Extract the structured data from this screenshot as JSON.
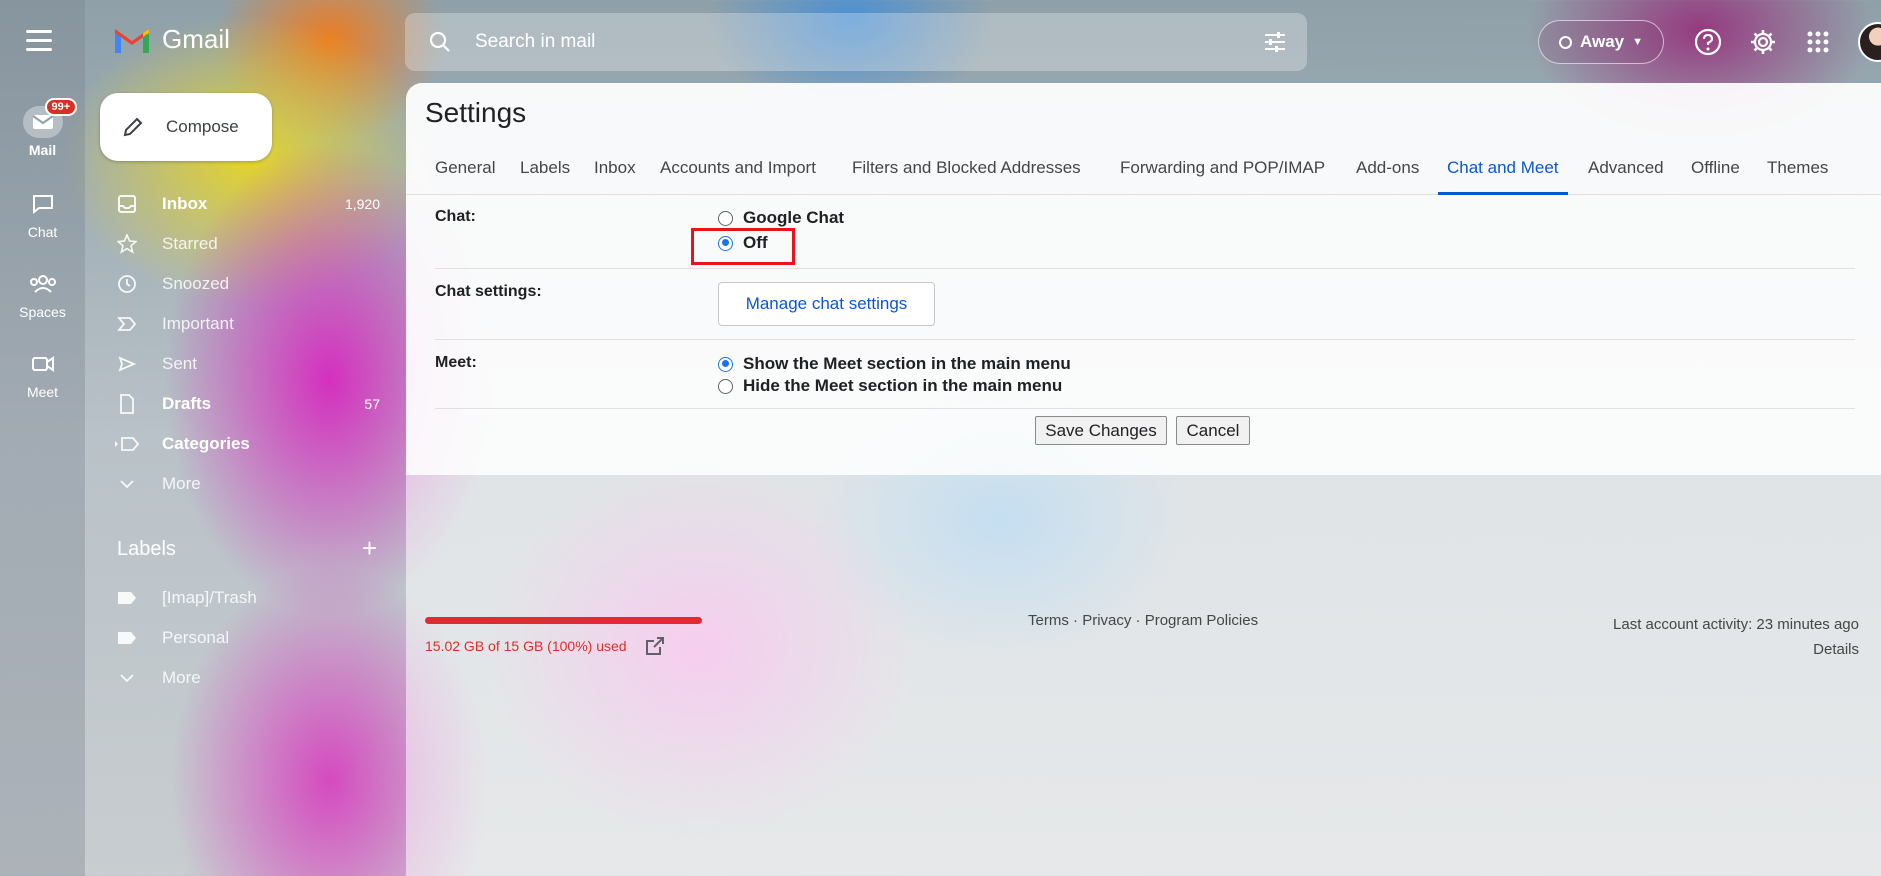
{
  "app": {
    "name": "Gmail"
  },
  "rail": {
    "items": [
      {
        "label": "Mail",
        "badge": "99+"
      },
      {
        "label": "Chat"
      },
      {
        "label": "Spaces"
      },
      {
        "label": "Meet"
      }
    ]
  },
  "compose": {
    "label": "Compose"
  },
  "nav": [
    {
      "label": "Inbox",
      "count": "1,920"
    },
    {
      "label": "Starred"
    },
    {
      "label": "Snoozed"
    },
    {
      "label": "Important"
    },
    {
      "label": "Sent"
    },
    {
      "label": "Drafts",
      "count": "57"
    },
    {
      "label": "Categories"
    },
    {
      "label": "More"
    }
  ],
  "labels": {
    "heading": "Labels",
    "items": [
      "[Imap]/Trash",
      "Personal"
    ],
    "more": "More"
  },
  "search": {
    "placeholder": "Search in mail"
  },
  "status": {
    "label": "Away"
  },
  "settings": {
    "title": "Settings",
    "tabs": [
      "General",
      "Labels",
      "Inbox",
      "Accounts and Import",
      "Filters and Blocked Addresses",
      "Forwarding and POP/IMAP",
      "Add-ons",
      "Chat and Meet",
      "Advanced",
      "Offline",
      "Themes"
    ],
    "active_tab": "Chat and Meet",
    "chat": {
      "label": "Chat:",
      "options": [
        "Google Chat",
        "Off"
      ],
      "selected": "Off"
    },
    "chat_settings": {
      "label": "Chat settings:",
      "button": "Manage chat settings"
    },
    "meet": {
      "label": "Meet:",
      "options": [
        "Show the Meet section in the main menu",
        "Hide the Meet section in the main menu"
      ],
      "selected": "Show the Meet section in the main menu"
    },
    "save_label": "Save Changes",
    "cancel_label": "Cancel"
  },
  "footer": {
    "storage": "15.02 GB of 15 GB (100%) used",
    "storage_fraction": 1.0,
    "terms": "Terms",
    "privacy": "Privacy",
    "policies": "Program Policies",
    "separator": " · ",
    "activity": "Last account activity: 23 minutes ago",
    "details": "Details"
  },
  "colors": {
    "accent": "#0b57d0",
    "highlight": "#e8141a",
    "storage_warning": "#d93025"
  }
}
